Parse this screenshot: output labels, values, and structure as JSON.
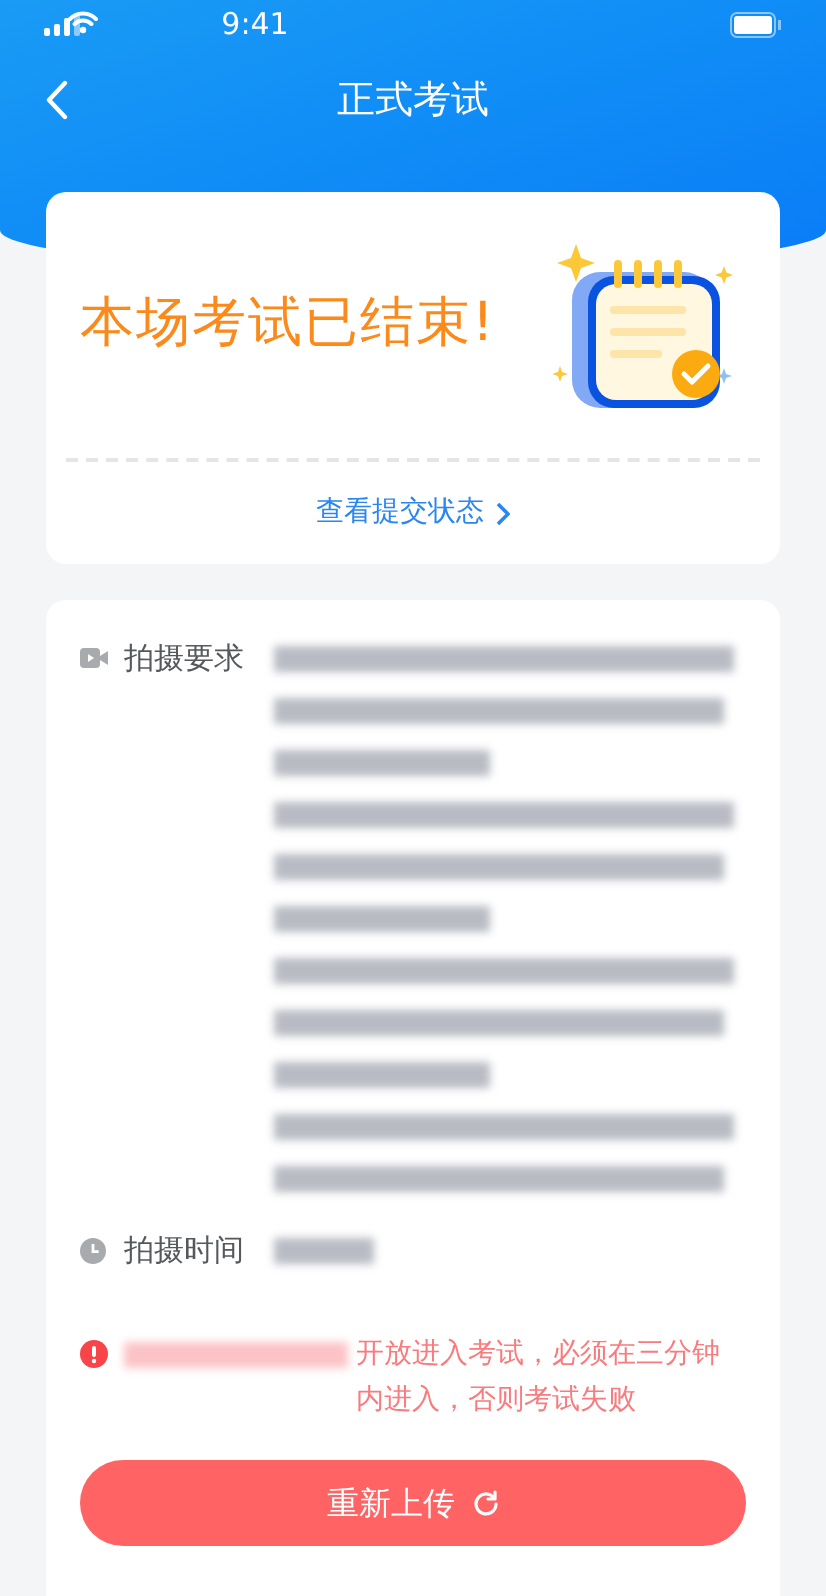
{
  "status_bar": {
    "time": "9:41"
  },
  "nav": {
    "title": "正式考试"
  },
  "result_card": {
    "headline": "本场考试已结束!",
    "link": "查看提交状态"
  },
  "details": [
    {
      "kind": "video",
      "label": "拍摄要求",
      "value_redacted": true
    },
    {
      "kind": "clock",
      "label": "拍摄时间",
      "value_redacted": true
    }
  ],
  "notice": {
    "date_redacted": true,
    "text": "开放进入考试，必须在三分钟内进入，否则考试失败"
  },
  "button": {
    "label": "重新上传"
  }
}
